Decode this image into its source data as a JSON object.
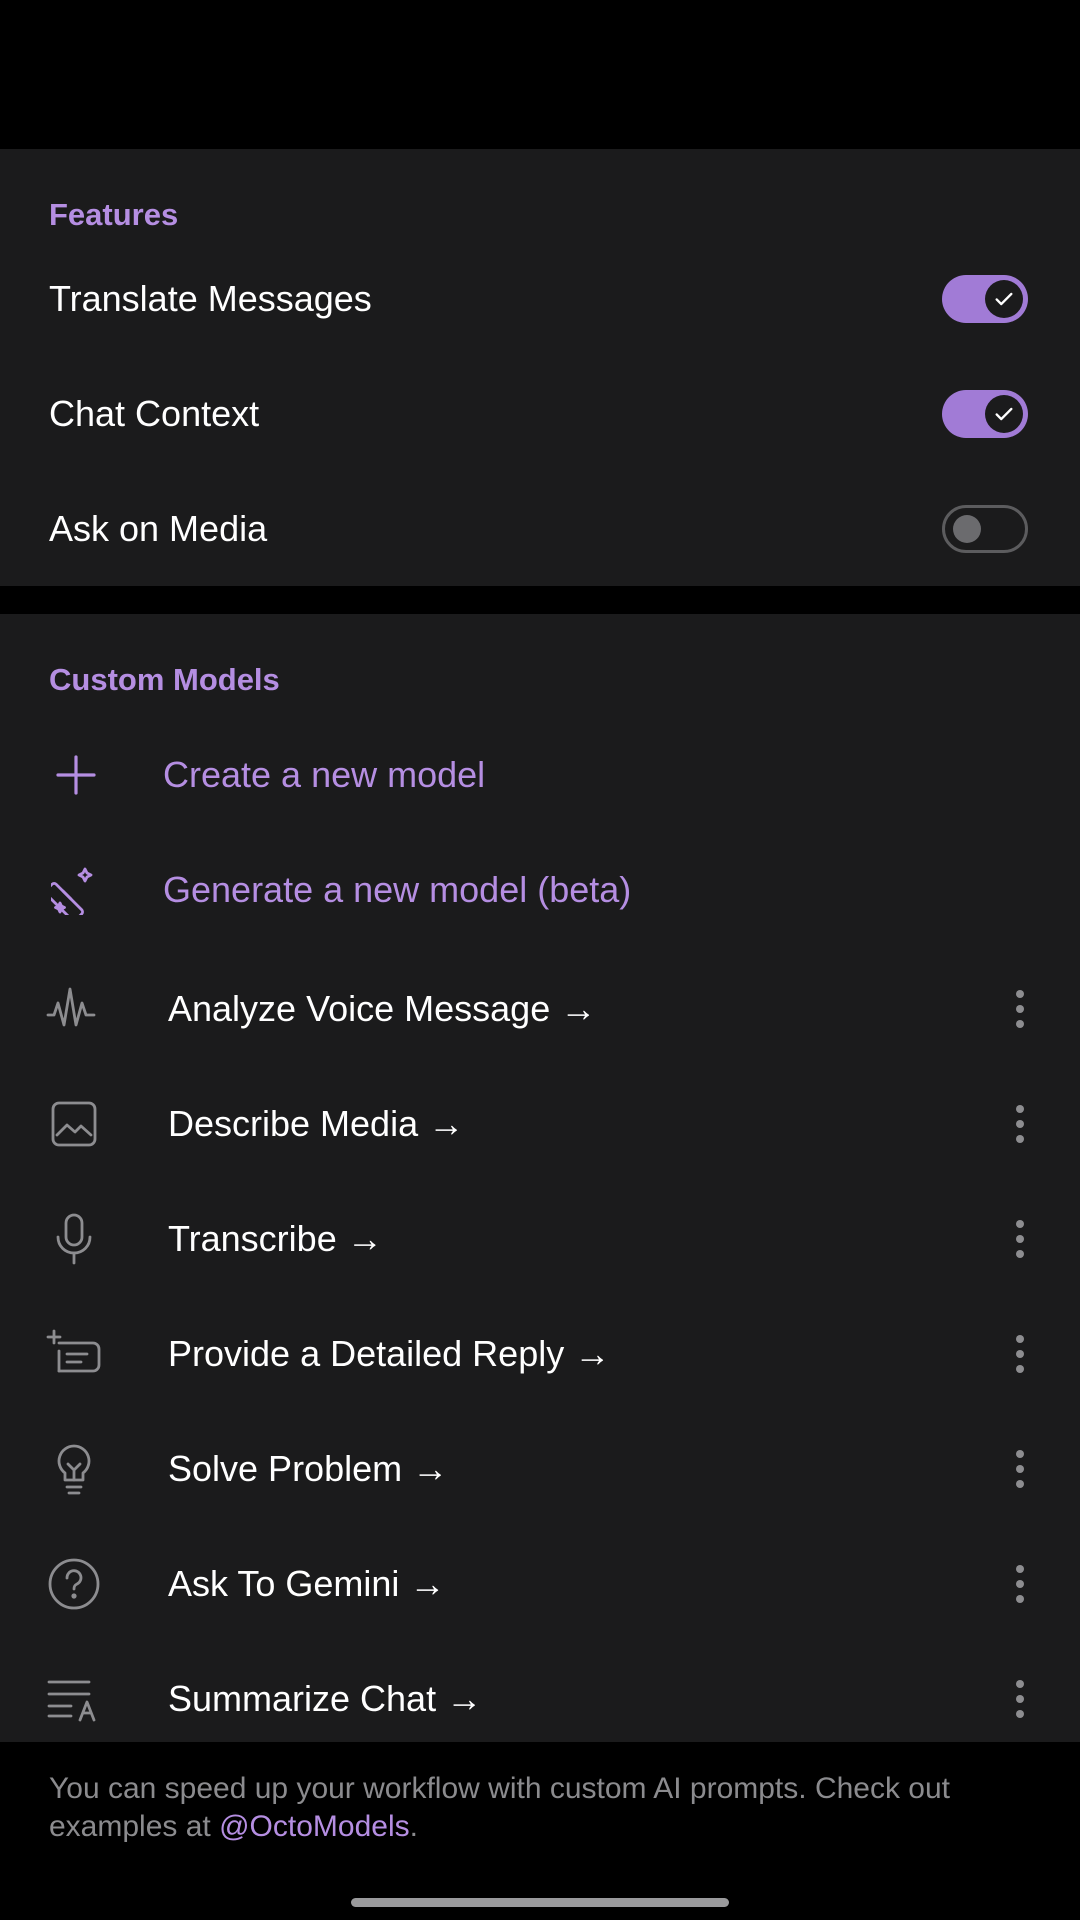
{
  "features": {
    "title": "Features",
    "items": [
      {
        "label": "Translate Messages",
        "enabled": true
      },
      {
        "label": "Chat Context",
        "enabled": true
      },
      {
        "label": "Ask on Media",
        "enabled": false
      }
    ]
  },
  "custom_models": {
    "title": "Custom Models",
    "actions": [
      {
        "label": "Create a new model",
        "icon": "plus-icon"
      },
      {
        "label": "Generate a new model (beta)",
        "icon": "magic-wand-icon"
      }
    ],
    "models": [
      {
        "label": "Analyze Voice Message →",
        "icon": "waveform-icon"
      },
      {
        "label": "Describe Media →",
        "icon": "image-icon"
      },
      {
        "label": "Transcribe →",
        "icon": "microphone-icon"
      },
      {
        "label": "Provide a Detailed Reply →",
        "icon": "reply-text-icon"
      },
      {
        "label": "Solve Problem →",
        "icon": "lightbulb-icon"
      },
      {
        "label": "Ask To Gemini →",
        "icon": "question-circle-icon"
      },
      {
        "label": "Summarize Chat →",
        "icon": "summarize-text-icon"
      }
    ]
  },
  "footer": {
    "text": "You can speed up your workflow with custom AI prompts. Check out examples at ",
    "link": "@OctoModels",
    "suffix": "."
  },
  "colors": {
    "accent": "#b58ee2",
    "toggle_on": "#a17bd6",
    "background": "#1b1b1c"
  }
}
